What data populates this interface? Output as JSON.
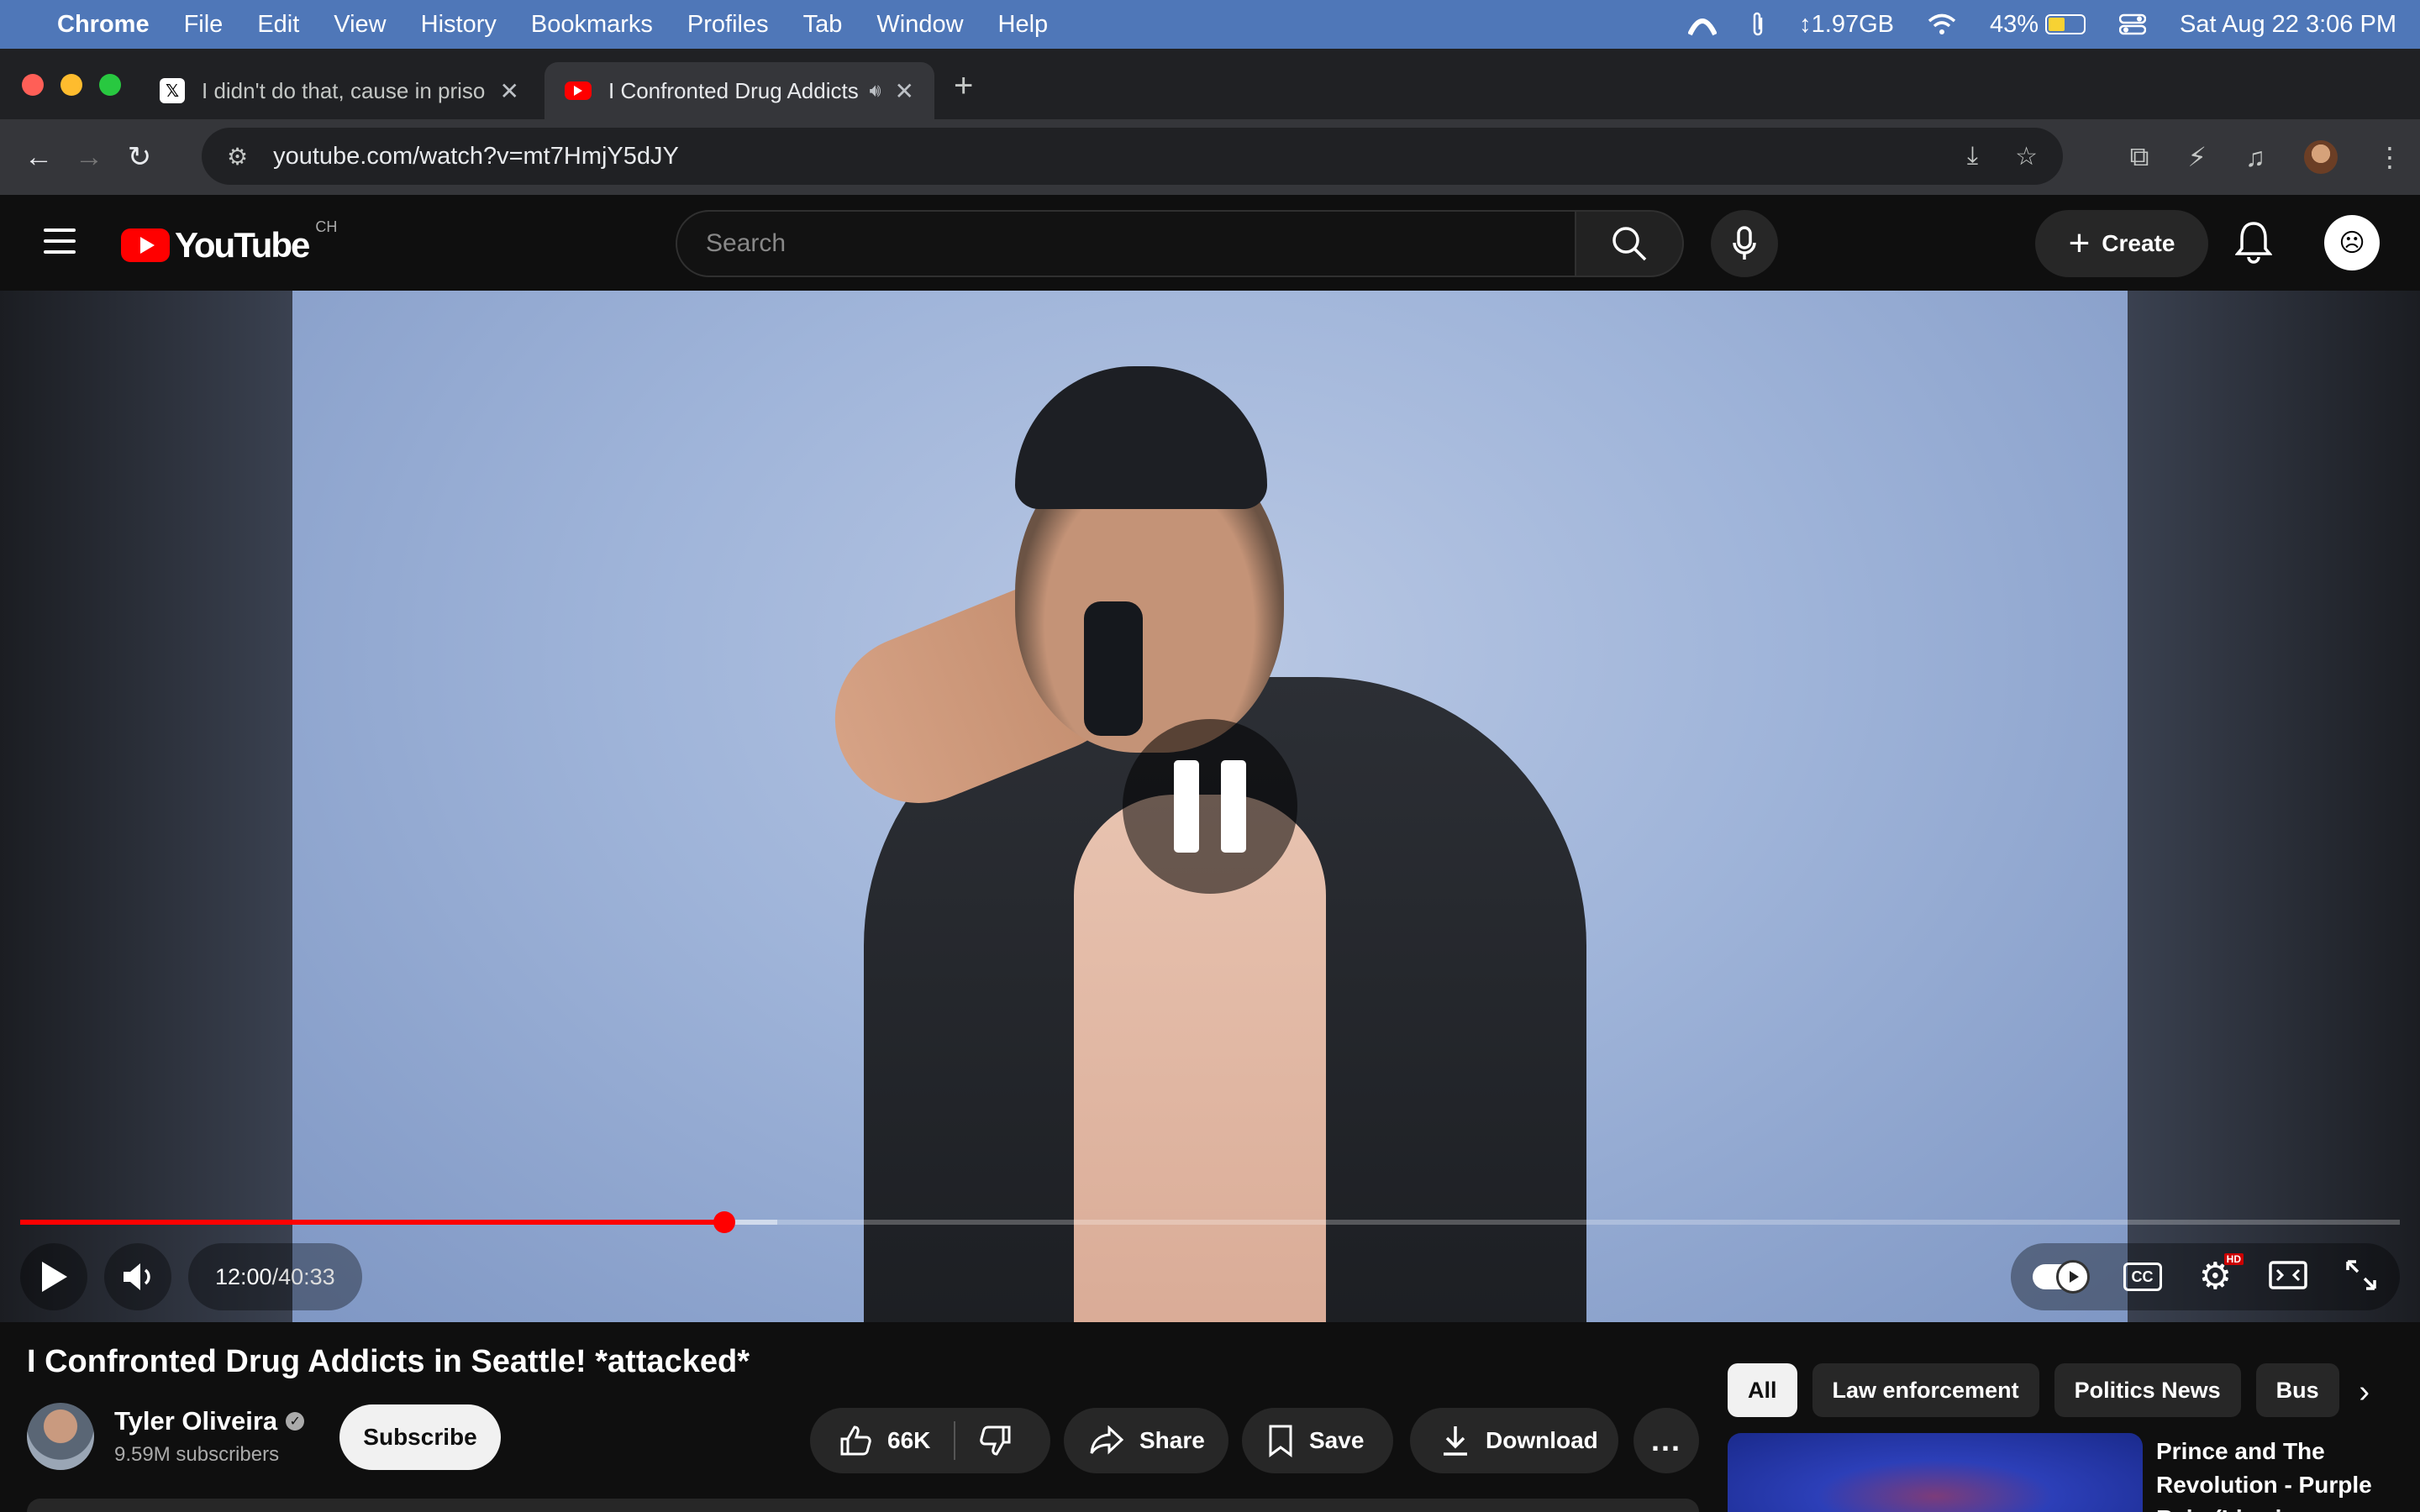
{
  "menubar": {
    "app": "Chrome",
    "items": [
      "File",
      "Edit",
      "View",
      "History",
      "Bookmarks",
      "Profiles",
      "Tab",
      "Window",
      "Help"
    ],
    "memory": "↕1.97GB",
    "battery_percent": "43%",
    "battery_level": 0.43,
    "datetime": "Sat Aug 22  3:06 PM"
  },
  "browser": {
    "tabs": [
      {
        "title": "I didn't do that, cause in prison",
        "active": false
      },
      {
        "title": "I Confronted Drug Addicts",
        "active": true
      }
    ],
    "url": "youtube.com/watch?v=mt7HmjY5dJY"
  },
  "youtube": {
    "logo_text": "YouTube",
    "region": "CH",
    "search_placeholder": "Search",
    "create_label": "Create"
  },
  "player": {
    "current_time": "12:00",
    "duration": "40:33",
    "time_separator": " / ",
    "played_fraction": 0.296,
    "buffered_fraction": 0.318,
    "cc_label": "CC",
    "hd_badge": "HD"
  },
  "video": {
    "title": "I Confronted Drug Addicts in Seattle! *attacked*",
    "channel": "Tyler Oliveira",
    "subscribers": "9.59M subscribers",
    "subscribe_label": "Subscribe",
    "likes": "66K",
    "share_label": "Share",
    "save_label": "Save",
    "download_label": "Download",
    "more_label": "..."
  },
  "sidebar": {
    "chips": [
      "All",
      "Law enforcement",
      "Politics News",
      "Bus"
    ],
    "recommendation_title": "Prince and The Revolution - Purple Rain (Live in Syracuse"
  },
  "colors": {
    "yt_red": "#ff0000",
    "menubar": "#4f77b8",
    "chip_selected": "#f1f1f1"
  }
}
